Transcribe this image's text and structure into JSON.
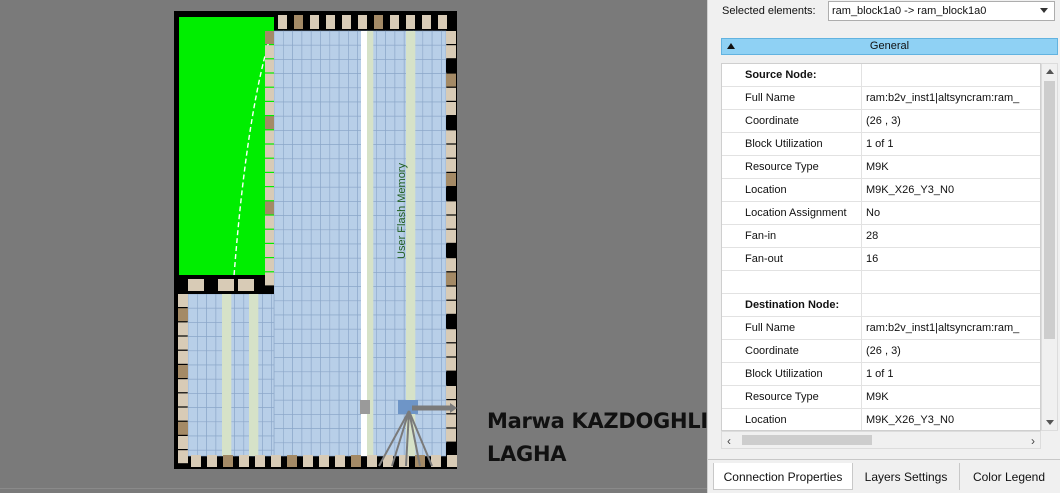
{
  "floorplan": {
    "region_label": "User Flash Memory",
    "colors": {
      "background": "#000000",
      "flash": "#00ee00",
      "lab": "#b8cfe8",
      "lab_grid": "#8aa6c8",
      "io_tile": "#d8cbb6",
      "io_used": "#a48a66",
      "m9k_column": "#d6e2c8",
      "selected_block": "#6e95c7",
      "gray_block": "#9a9a9a",
      "connection": "#7a7a7a",
      "route": "#ffffff"
    }
  },
  "author": {
    "line1": "Marwa KAZDOGHLI",
    "line2": "LAGHA"
  },
  "panel": {
    "selected_label": "Selected elements:",
    "selected_value": "ram_block1a0 -> ram_block1a0",
    "section_title": "General",
    "rows": [
      {
        "key": "Source Node:",
        "value": "",
        "header": true
      },
      {
        "key": "Full Name",
        "value": "ram:b2v_inst1|altsyncram:ram_"
      },
      {
        "key": "Coordinate",
        "value": "(26 , 3)"
      },
      {
        "key": "Block Utilization",
        "value": "1 of 1"
      },
      {
        "key": "Resource Type",
        "value": "M9K"
      },
      {
        "key": "Location",
        "value": "M9K_X26_Y3_N0"
      },
      {
        "key": "Location Assignment",
        "value": "No"
      },
      {
        "key": "Fan-in",
        "value": "28"
      },
      {
        "key": "Fan-out",
        "value": "16"
      },
      {
        "key": "",
        "value": ""
      },
      {
        "key": "Destination Node:",
        "value": "",
        "header": true
      },
      {
        "key": "Full Name",
        "value": "ram:b2v_inst1|altsyncram:ram_"
      },
      {
        "key": "Coordinate",
        "value": "(26 , 3)"
      },
      {
        "key": "Block Utilization",
        "value": "1 of 1"
      },
      {
        "key": "Resource Type",
        "value": "M9K"
      },
      {
        "key": "Location",
        "value": "M9K_X26_Y3_N0"
      }
    ],
    "tabs": [
      {
        "label": "Connection Properties",
        "active": true
      },
      {
        "label": "Layers Settings",
        "active": false
      },
      {
        "label": "Color Legend",
        "active": false
      }
    ],
    "accent": "#8fd1f4"
  }
}
